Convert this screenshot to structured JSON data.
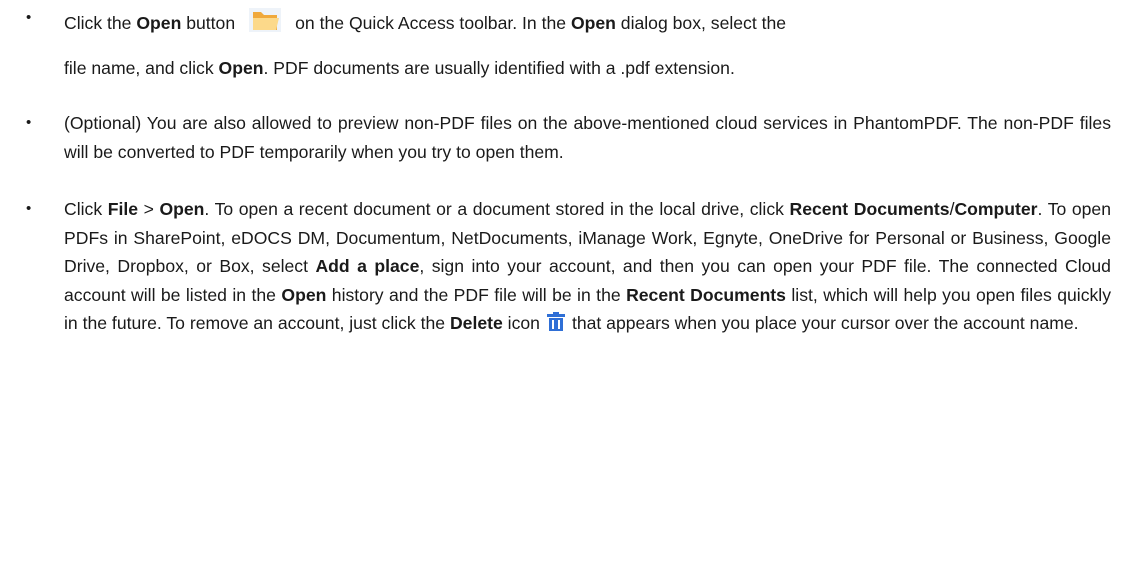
{
  "bullets": {
    "symbol": "•",
    "item1": {
      "p1": "Click the ",
      "b1": "Open",
      "p2": " button",
      "p3": "on the Quick Access toolbar. In the ",
      "b2": "Open",
      "p4": " dialog box, select the",
      "p5": "file name, and click ",
      "b3": "Open",
      "p6": ". PDF documents are usually identified with a .pdf extension.",
      "icon": "folder-open-icon"
    },
    "item2": {
      "text": "(Optional) You are also allowed to preview non-PDF files on the above-mentioned cloud services in PhantomPDF. The non-PDF files will be converted to PDF temporarily when you try to open them."
    },
    "item3": {
      "p1": "Click ",
      "b1": "File",
      "p2": " > ",
      "b2": "Open",
      "p3": ". To open a recent document or a document stored in the local drive, click ",
      "b3": "Recent Documents",
      "p4": "/",
      "b4": "Computer",
      "p5": ". To open PDFs in SharePoint, eDOCS DM, Documentum, NetDocuments, iManage Work, Egnyte, OneDrive for Personal or Business, Google Drive, Dropbox, or Box, select ",
      "b5": "Add a place",
      "p6": ", sign into your account, and then you can open your PDF file. The connected Cloud account will be listed in the ",
      "b6": "Open",
      "p7": " history and the PDF file will be in the ",
      "b7": "Recent Documents",
      "p8": " list, which will help you open files quickly in the future. To remove an account, just click the ",
      "b8": "Delete",
      "p9": " icon",
      "p10": "that appears when you place your cursor over the account name.",
      "icon": "trash-delete-icon"
    }
  },
  "colors": {
    "folder_light": "#fcd98a",
    "folder_dark": "#f0a93c",
    "delete_blue": "#2f6fd6",
    "text": "#1a1a1a"
  }
}
